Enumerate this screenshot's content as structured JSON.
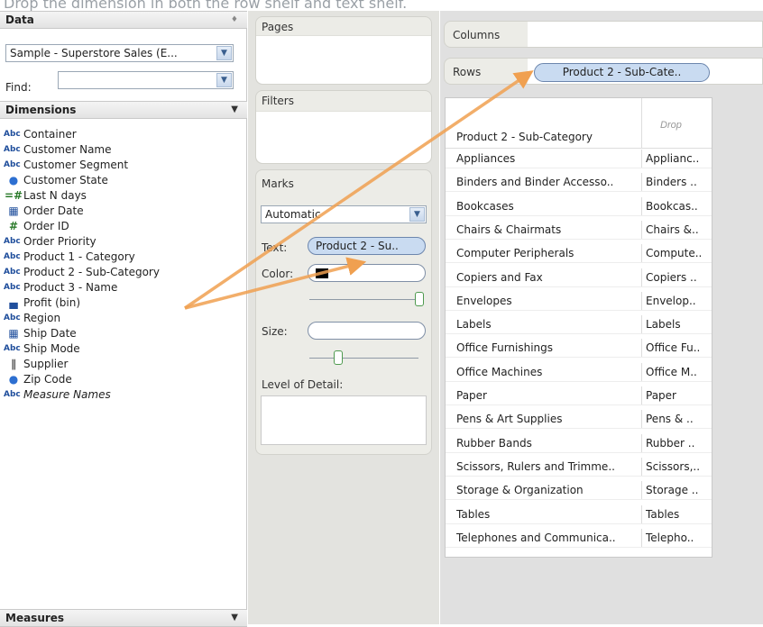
{
  "caption": "Drop the dimension in both the row shelf and text shelf.",
  "data_panel": {
    "title": "Data",
    "data_source": "Sample - Superstore Sales (E...",
    "find_label": "Find:",
    "find_value": ""
  },
  "dimensions": {
    "title": "Dimensions",
    "items": [
      {
        "type": "Abc",
        "label": "Container"
      },
      {
        "type": "Abc",
        "label": "Customer Name"
      },
      {
        "type": "Abc",
        "label": "Customer Segment"
      },
      {
        "type": "globe",
        "label": "Customer State"
      },
      {
        "type": "=#",
        "label": "Last N days"
      },
      {
        "type": "cal",
        "label": "Order Date"
      },
      {
        "type": "#",
        "label": "Order ID"
      },
      {
        "type": "Abc",
        "label": "Order Priority"
      },
      {
        "type": "Abc",
        "label": "Product 1 - Category"
      },
      {
        "type": "Abc",
        "label": "Product 2 - Sub-Category"
      },
      {
        "type": "Abc",
        "label": "Product 3 - Name"
      },
      {
        "type": "bin",
        "label": "Profit (bin)"
      },
      {
        "type": "Abc",
        "label": "Region"
      },
      {
        "type": "cal",
        "label": "Ship Date"
      },
      {
        "type": "Abc",
        "label": "Ship Mode"
      },
      {
        "type": "clip",
        "label": "Supplier"
      },
      {
        "type": "globe",
        "label": "Zip Code"
      },
      {
        "type": "Abc",
        "label": "Measure Names",
        "italic": true
      }
    ]
  },
  "measures": {
    "title": "Measures"
  },
  "shelves": {
    "pages": "Pages",
    "filters": "Filters",
    "marks": "Marks",
    "mark_type": "Automatic",
    "text_label": "Text:",
    "text_pill": "Product 2 - Su..",
    "color_label": "Color:",
    "size_label": "Size:",
    "level_of_detail": "Level of Detail:"
  },
  "view": {
    "columns_label": "Columns",
    "rows_label": "Rows",
    "rows_pill": "Product 2 - Sub-Cate..",
    "header": "Product 2 - Sub-Category",
    "drop_hint": "Drop",
    "rows": [
      {
        "name": "Appliances",
        "text": "Applianc.."
      },
      {
        "name": "Binders and Binder Accesso..",
        "text": "Binders .."
      },
      {
        "name": "Bookcases",
        "text": "Bookcas.."
      },
      {
        "name": "Chairs & Chairmats",
        "text": "Chairs &.."
      },
      {
        "name": "Computer Peripherals",
        "text": "Compute.."
      },
      {
        "name": "Copiers and Fax",
        "text": "Copiers .."
      },
      {
        "name": "Envelopes",
        "text": "Envelop.."
      },
      {
        "name": "Labels",
        "text": "Labels"
      },
      {
        "name": "Office Furnishings",
        "text": "Office Fu.."
      },
      {
        "name": "Office Machines",
        "text": "Office M.."
      },
      {
        "name": "Paper",
        "text": "Paper"
      },
      {
        "name": "Pens & Art Supplies",
        "text": "Pens & .."
      },
      {
        "name": "Rubber Bands",
        "text": "Rubber .."
      },
      {
        "name": "Scissors, Rulers and Trimme..",
        "text": "Scissors,.."
      },
      {
        "name": "Storage & Organization",
        "text": "Storage .."
      },
      {
        "name": "Tables",
        "text": "Tables"
      },
      {
        "name": "Telephones and Communica..",
        "text": "Telepho.."
      }
    ]
  },
  "colors": {
    "arrow": "#f0a050",
    "pill": "#c9dbf1",
    "icon_blue": "#1f4e9c"
  }
}
